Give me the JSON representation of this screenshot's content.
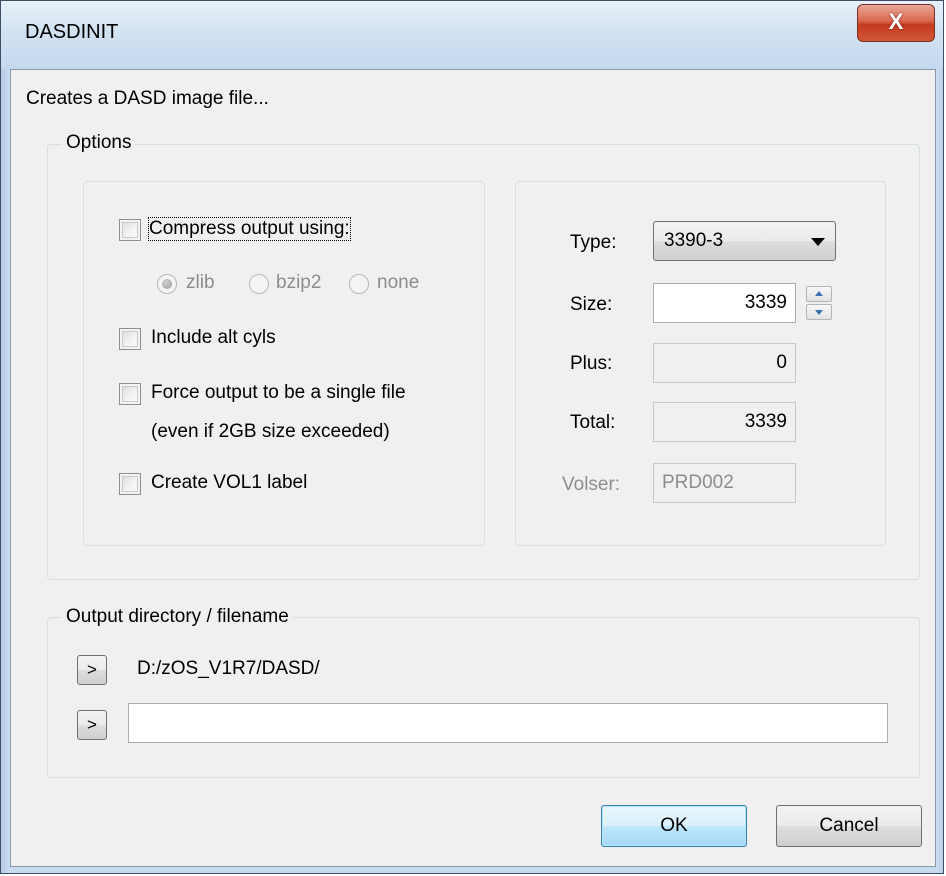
{
  "window": {
    "title": "DASDINIT",
    "close_glyph": "X"
  },
  "description": "Creates a DASD image file...",
  "options": {
    "legend": "Options",
    "compress_label": "Compress output using:",
    "compress_checked": false,
    "compression_options": [
      {
        "label": "zlib",
        "selected": true
      },
      {
        "label": "bzip2",
        "selected": false
      },
      {
        "label": "none",
        "selected": false
      }
    ],
    "include_alt_cyls_label": "Include alt cyls",
    "force_single_file_label": "Force output to be a single file",
    "force_single_file_note": "(even if 2GB size exceeded)",
    "create_vol1_label": "Create VOL1 label"
  },
  "device": {
    "type_label": "Type:",
    "type_value": "3390-3",
    "size_label": "Size:",
    "size_value": "3339",
    "plus_label": "Plus:",
    "plus_value": "0",
    "total_label": "Total:",
    "total_value": "3339",
    "volser_label": "Volser:",
    "volser_placeholder": "PRD002"
  },
  "output": {
    "legend": "Output directory / filename",
    "browse_glyph": ">",
    "directory": "D:/zOS_V1R7/DASD/",
    "filename_value": ""
  },
  "buttons": {
    "ok": "OK",
    "cancel": "Cancel"
  }
}
